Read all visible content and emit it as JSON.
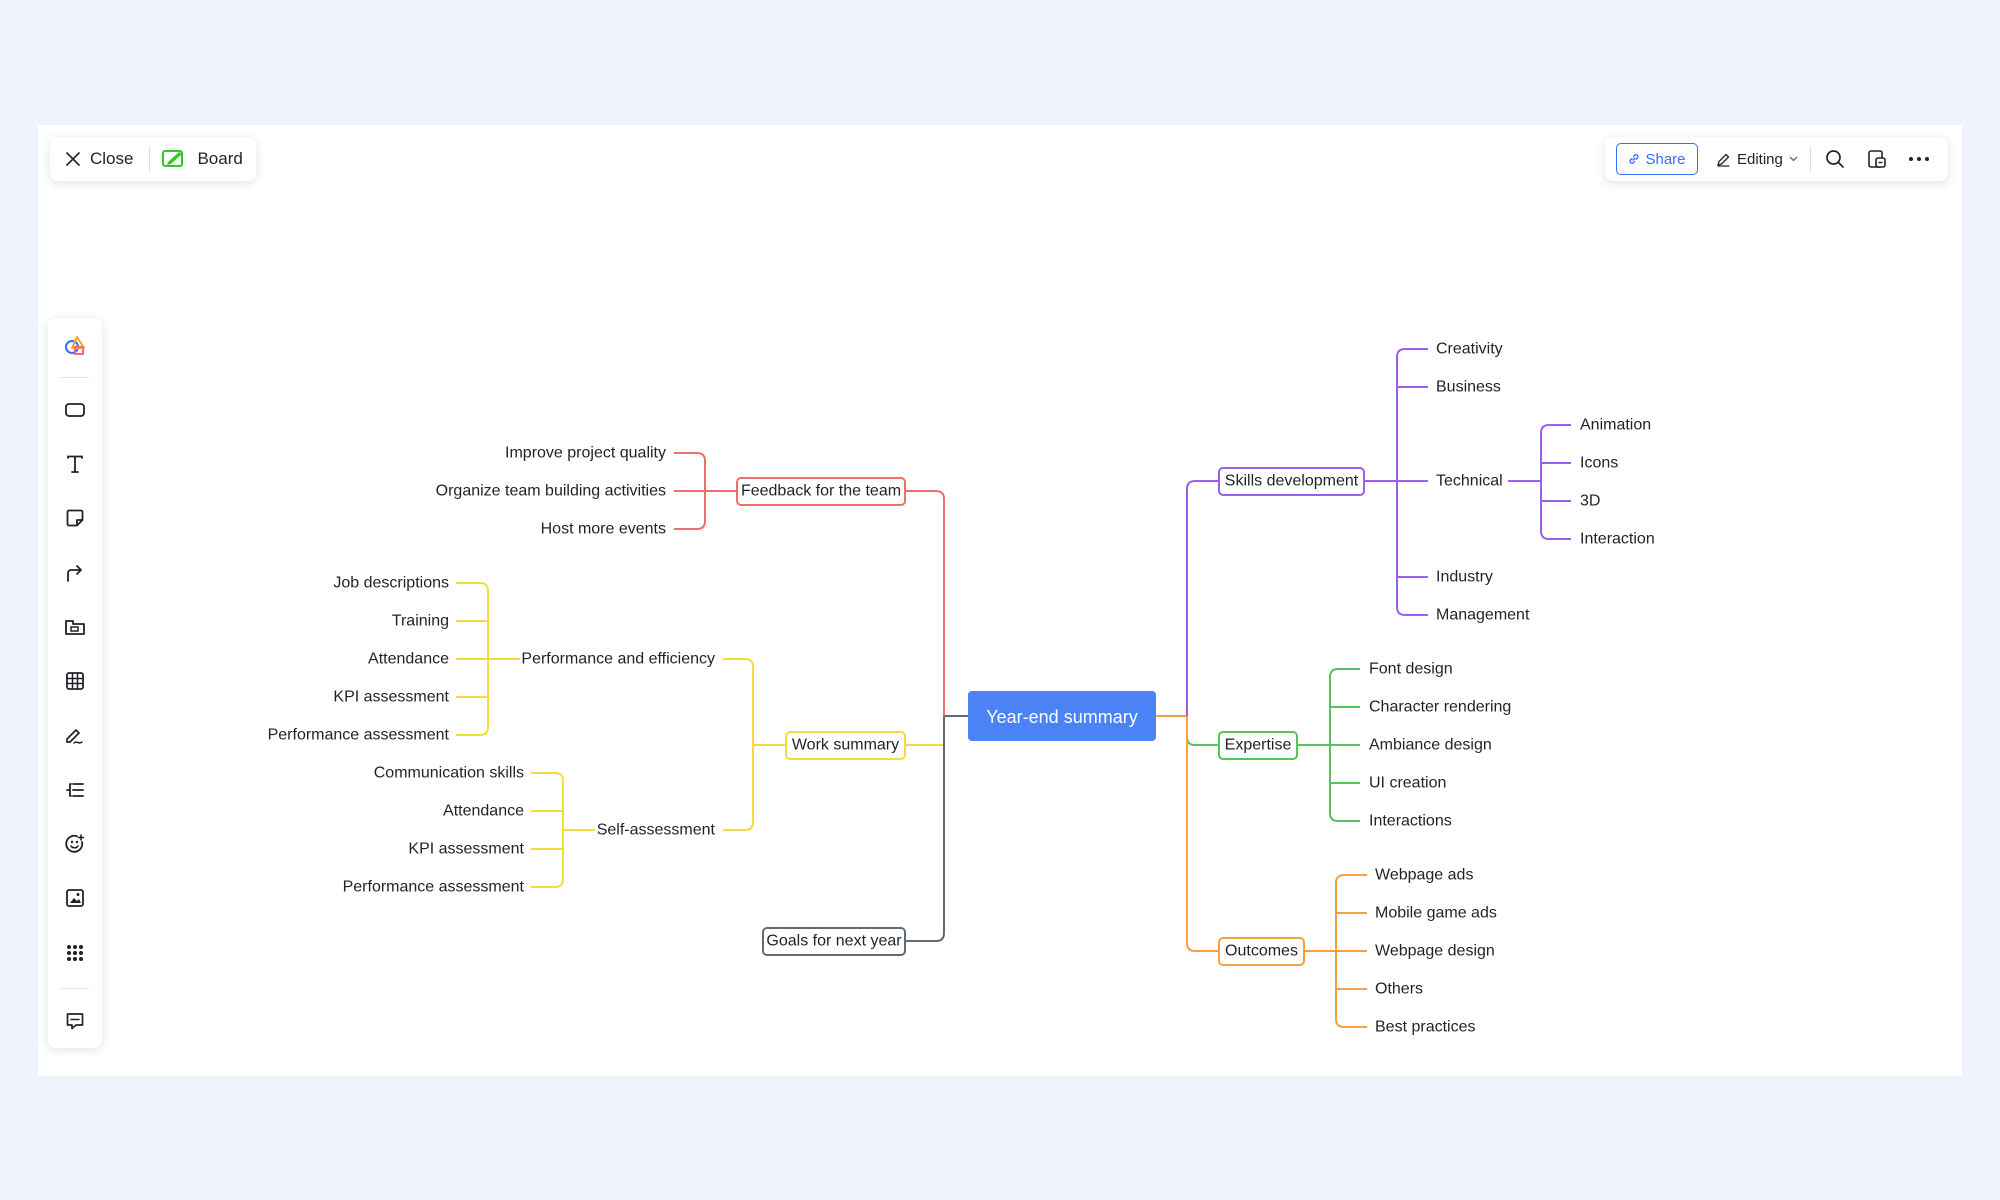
{
  "header": {
    "close_label": "Close",
    "board_label": "Board",
    "share_label": "Share",
    "editing_label": "Editing"
  },
  "toolbar": {
    "tools": [
      "shapes-icon",
      "rectangle-icon",
      "text-icon",
      "sticky-note-icon",
      "connector-icon",
      "frame-icon",
      "table-icon",
      "pen-icon",
      "mind-map-icon",
      "emoji-icon",
      "image-icon",
      "more-apps-icon",
      "comment-icon"
    ]
  },
  "colors": {
    "background": "#eef3fc",
    "accent": "#3370ff",
    "root": "#4b83f7",
    "red": "#f26d6d",
    "yellow": "#f5dc3c",
    "gray": "#646a73",
    "purple": "#9b5ff0",
    "green": "#54c45a",
    "orange": "#f5a13d"
  },
  "mindmap": {
    "root": "Year-end summary",
    "feedback": {
      "label": "Feedback for the team",
      "children": [
        "Improve project quality",
        "Organize team building activities",
        "Host more events"
      ]
    },
    "work_summary": {
      "label": "Work summary",
      "performance": {
        "label": "Performance and efficiency",
        "children": [
          "Job descriptions",
          "Training",
          "Attendance",
          "KPI assessment",
          "Performance assessment"
        ]
      },
      "self_assessment": {
        "label": "Self-assessment",
        "children": [
          "Communication skills",
          "Attendance",
          "KPI assessment",
          "Performance assessment"
        ]
      }
    },
    "goals": {
      "label": "Goals for next year"
    },
    "skills": {
      "label": "Skills development",
      "children": [
        "Creativity",
        "Business",
        "Technical",
        "Industry",
        "Management"
      ],
      "technical": [
        "Animation",
        "Icons",
        "3D",
        "Interaction"
      ]
    },
    "expertise": {
      "label": "Expertise",
      "children": [
        "Font design",
        "Character rendering",
        "Ambiance design",
        "UI creation",
        "Interactions"
      ]
    },
    "outcomes": {
      "label": "Outcomes",
      "children": [
        "Webpage ads",
        "Mobile game ads",
        "Webpage design",
        "Others",
        "Best practices"
      ]
    }
  }
}
